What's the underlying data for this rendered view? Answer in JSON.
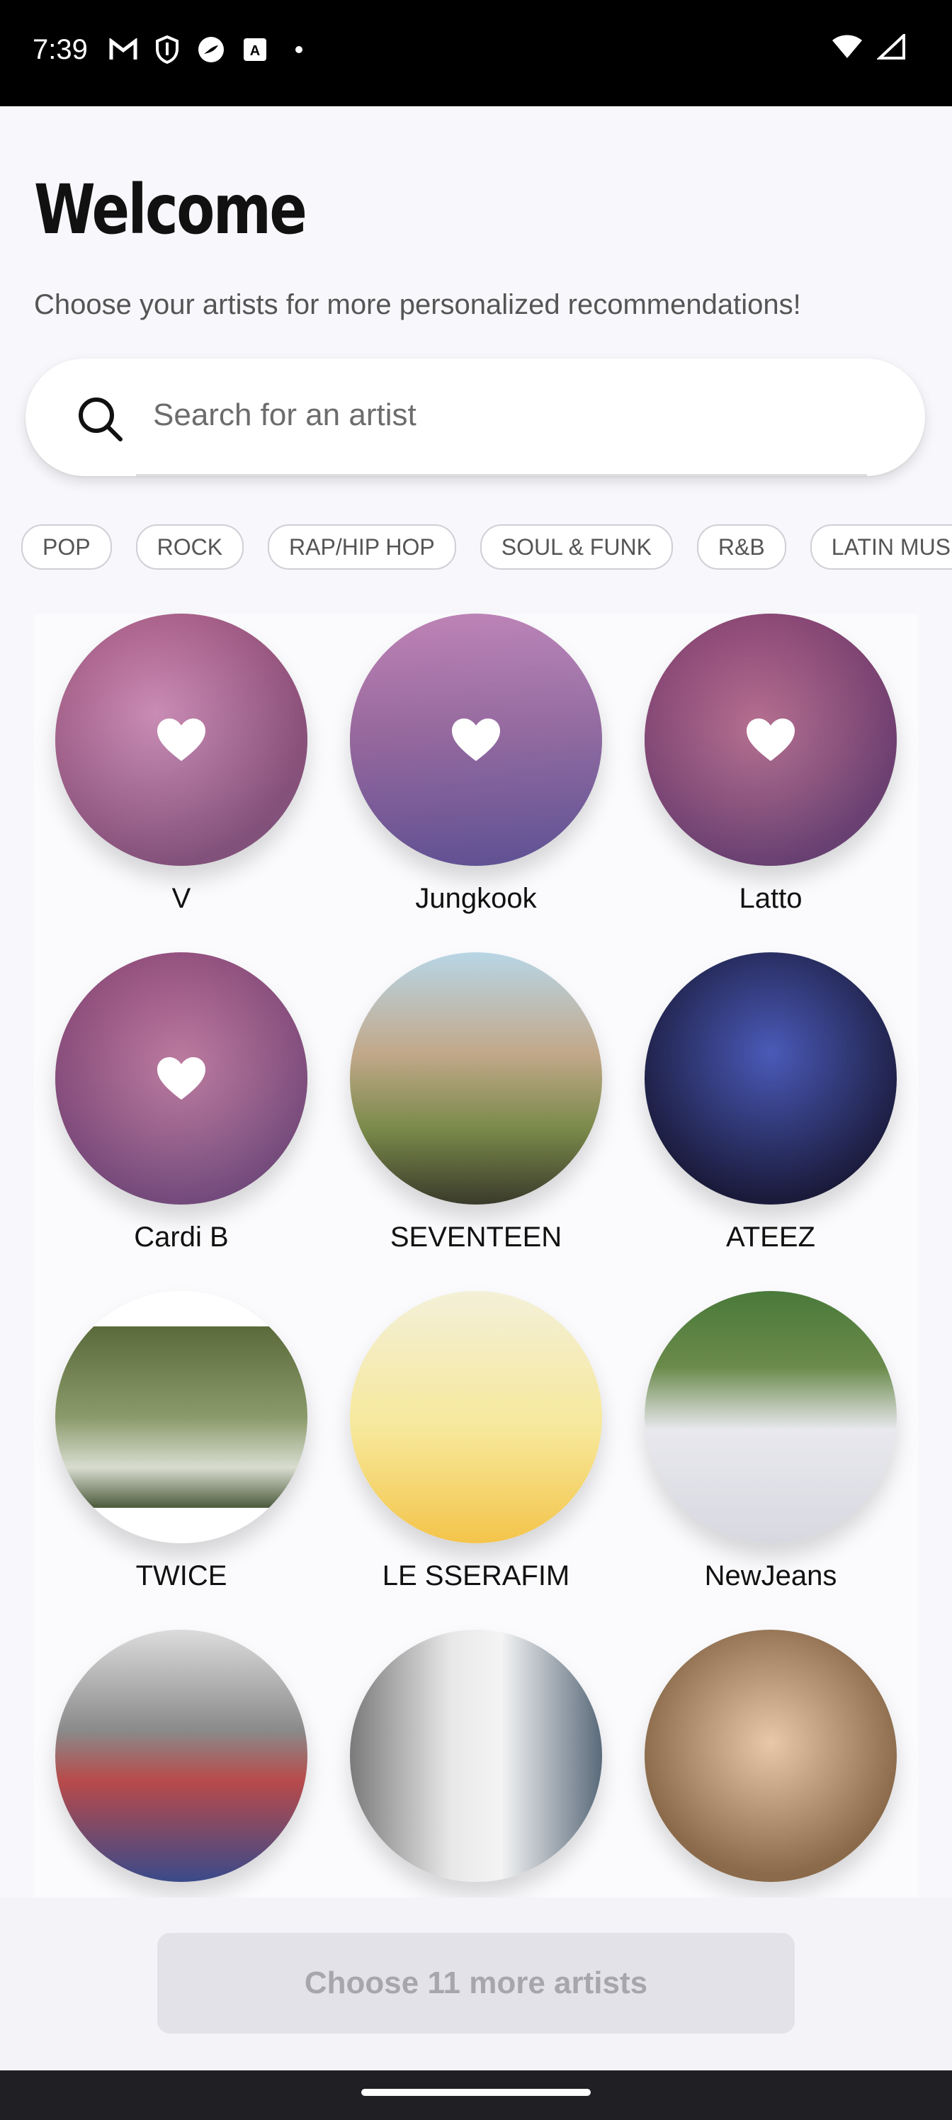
{
  "status_bar": {
    "time": "7:39"
  },
  "header": {
    "title": "Welcome",
    "subtitle": "Choose your artists for more personalized recommendations!"
  },
  "search": {
    "placeholder": "Search for an artist"
  },
  "genres": [
    "POP",
    "ROCK",
    "RAP/HIP HOP",
    "SOUL & FUNK",
    "R&B",
    "LATIN MUSIC"
  ],
  "artists": [
    {
      "name": "V",
      "selected": true
    },
    {
      "name": "Jungkook",
      "selected": true
    },
    {
      "name": "Latto",
      "selected": true
    },
    {
      "name": "Cardi B",
      "selected": true
    },
    {
      "name": "SEVENTEEN",
      "selected": false
    },
    {
      "name": "ATEEZ",
      "selected": false
    },
    {
      "name": "TWICE",
      "selected": false
    },
    {
      "name": "LE SSERAFIM",
      "selected": false
    },
    {
      "name": "NewJeans",
      "selected": false
    },
    {
      "name": "",
      "selected": false
    },
    {
      "name": "",
      "selected": false
    },
    {
      "name": "",
      "selected": false
    }
  ],
  "cta": {
    "label": "Choose 11 more artists"
  },
  "colors": {
    "accent_tint": "#b654aa",
    "cta_bg": "#e3e2e8",
    "cta_text": "#a6a6ac"
  }
}
